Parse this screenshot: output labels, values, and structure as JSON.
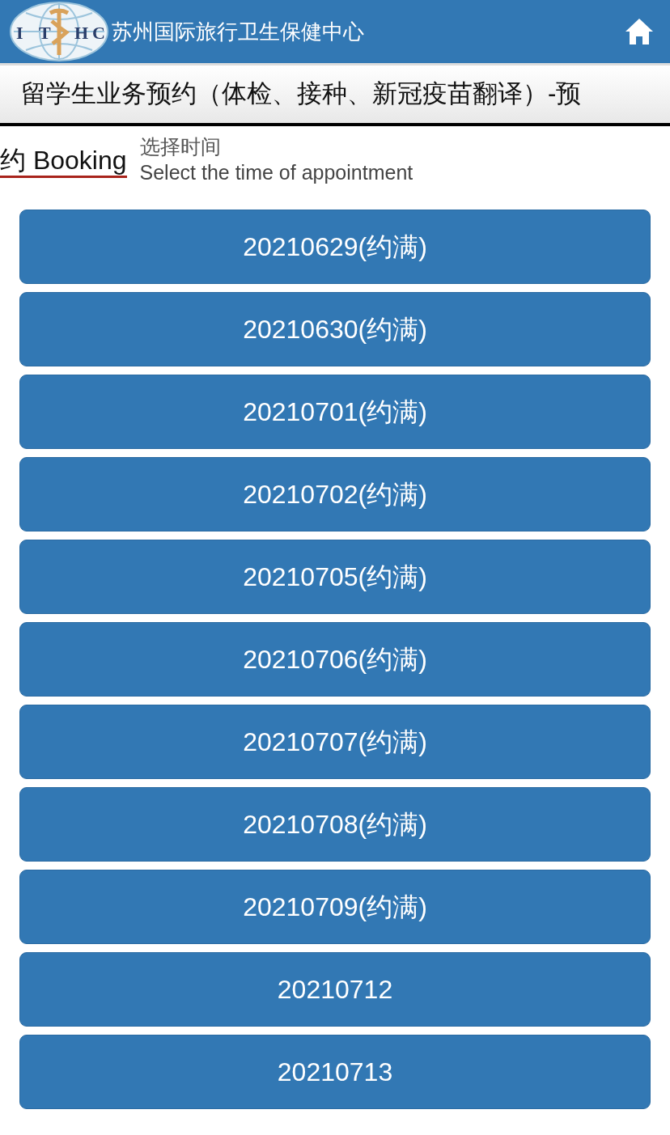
{
  "header": {
    "logo_letters": [
      "I",
      "T",
      "H",
      "C"
    ],
    "title": "苏州国际旅行卫生保健中心"
  },
  "page_title": {
    "line_1": "留学生业务预约（体检、接种、新冠疫苗翻译）-预",
    "line_2": "约 Booking"
  },
  "section": {
    "heading": "选择时间",
    "subheading": "Select the time of appointment"
  },
  "dates": [
    {
      "label": "20210629(约满)"
    },
    {
      "label": "20210630(约满)"
    },
    {
      "label": "20210701(约满)"
    },
    {
      "label": "20210702(约满)"
    },
    {
      "label": "20210705(约满)"
    },
    {
      "label": "20210706(约满)"
    },
    {
      "label": "20210707(约满)"
    },
    {
      "label": "20210708(约满)"
    },
    {
      "label": "20210709(约满)"
    },
    {
      "label": "20210712"
    },
    {
      "label": "20210713"
    }
  ]
}
